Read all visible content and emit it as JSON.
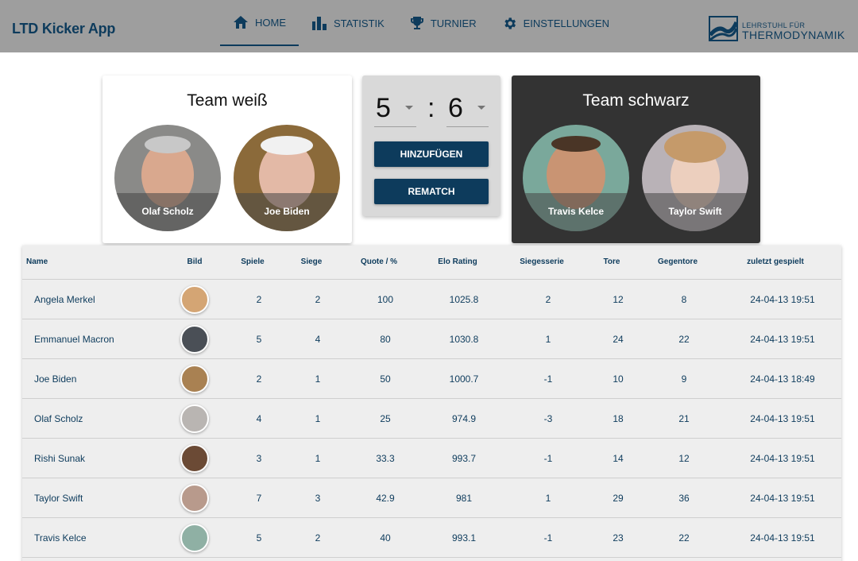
{
  "app": {
    "title": "LTD Kicker App"
  },
  "nav": {
    "items": [
      {
        "label": "HOME",
        "icon": "home-icon",
        "active": true
      },
      {
        "label": "STATISTIK",
        "icon": "bar-chart-icon",
        "active": false
      },
      {
        "label": "TURNIER",
        "icon": "trophy-icon",
        "active": false
      },
      {
        "label": "EINSTELLUNGEN",
        "icon": "gear-icon",
        "active": false
      }
    ]
  },
  "logo": {
    "line1": "LEHRSTUHL FÜR",
    "line2": "THERMODYNAMIK"
  },
  "teams": {
    "white": {
      "title": "Team weiß",
      "players": [
        "Olaf Scholz",
        "Joe Biden"
      ]
    },
    "black": {
      "title": "Team schwarz",
      "players": [
        "Travis Kelce",
        "Taylor Swift"
      ]
    }
  },
  "score": {
    "white": "5",
    "black": "6",
    "separator": ":"
  },
  "buttons": {
    "add": "HINZUFÜGEN",
    "rematch": "REMATCH"
  },
  "table": {
    "headers": [
      "Name",
      "Bild",
      "Spiele",
      "Siege",
      "Quote / %",
      "Elo Rating",
      "Siegesserie",
      "Tore",
      "Gegentore",
      "zuletzt gespielt"
    ],
    "rows": [
      {
        "name": "Angela Merkel",
        "spiele": "2",
        "siege": "2",
        "quote": "100",
        "elo": "1025.8",
        "serie": "2",
        "tore": "12",
        "gegentore": "8",
        "zuletzt": "24-04-13 19:51"
      },
      {
        "name": "Emmanuel Macron",
        "spiele": "5",
        "siege": "4",
        "quote": "80",
        "elo": "1030.8",
        "serie": "1",
        "tore": "24",
        "gegentore": "22",
        "zuletzt": "24-04-13 19:51"
      },
      {
        "name": "Joe Biden",
        "spiele": "2",
        "siege": "1",
        "quote": "50",
        "elo": "1000.7",
        "serie": "-1",
        "tore": "10",
        "gegentore": "9",
        "zuletzt": "24-04-13 18:49"
      },
      {
        "name": "Olaf Scholz",
        "spiele": "4",
        "siege": "1",
        "quote": "25",
        "elo": "974.9",
        "serie": "-3",
        "tore": "18",
        "gegentore": "21",
        "zuletzt": "24-04-13 19:51"
      },
      {
        "name": "Rishi Sunak",
        "spiele": "3",
        "siege": "1",
        "quote": "33.3",
        "elo": "993.7",
        "serie": "-1",
        "tore": "14",
        "gegentore": "12",
        "zuletzt": "24-04-13 19:51"
      },
      {
        "name": "Taylor Swift",
        "spiele": "7",
        "siege": "3",
        "quote": "42.9",
        "elo": "981",
        "serie": "1",
        "tore": "29",
        "gegentore": "36",
        "zuletzt": "24-04-13 19:51"
      },
      {
        "name": "Travis Kelce",
        "spiele": "5",
        "siege": "2",
        "quote": "40",
        "elo": "993.1",
        "serie": "-1",
        "tore": "23",
        "gegentore": "22",
        "zuletzt": "24-04-13 19:51"
      }
    ]
  },
  "colors": {
    "primary": "#0d3b5c",
    "appbar": "#9e9e9e",
    "team_black_bg": "#333333",
    "score_bg": "#d9d9d9",
    "table_bg": "#eeeeee"
  }
}
